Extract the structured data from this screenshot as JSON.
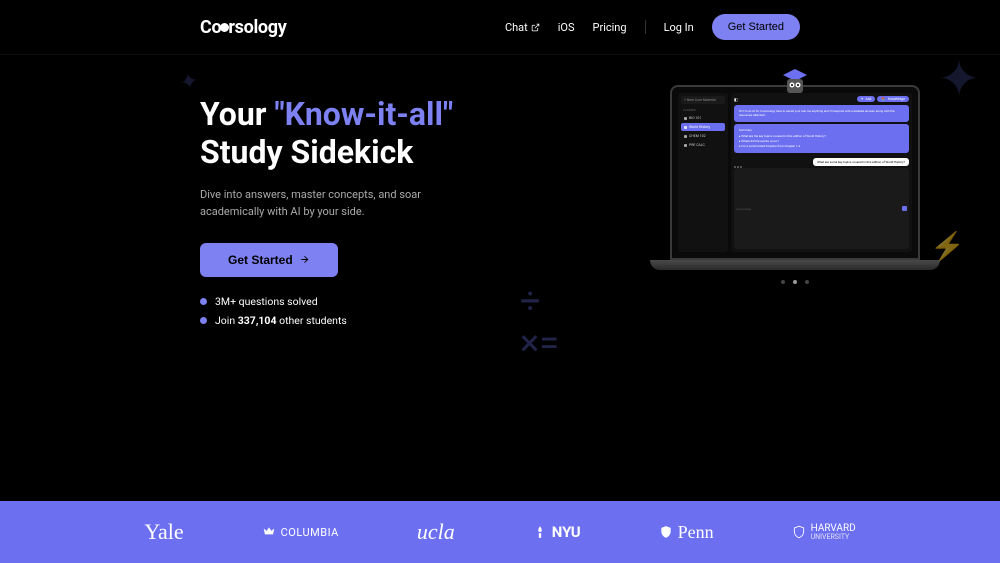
{
  "brand": "Coursology",
  "nav": {
    "chat": "Chat",
    "ios": "iOS",
    "pricing": "Pricing",
    "login": "Log In",
    "get_started": "Get Started"
  },
  "hero": {
    "headline_1": "Your ",
    "headline_accent": "\"Know-it-all\"",
    "headline_2": "Study Sidekick",
    "sub": "Dive into answers, master concepts, and soar academically with AI by your side.",
    "cta": "Get Started",
    "stat1": "3M+ questions solved",
    "stat2_pre": "Join ",
    "stat2_num": "337,104",
    "stat2_post": " other students"
  },
  "app": {
    "new_material": "+ New Core Material",
    "section": "CLASSES",
    "items": [
      "BIO 101",
      "World History",
      "CHEM 102",
      "PRE CALC"
    ],
    "top_pill1": "Ask",
    "top_pill2": "Knowledge",
    "chat_intro": "Hi! I'm an AI for Coursology here to assist you! Ask me anything and I'll respond with a detailed answer, along with the resources attached.",
    "chat_header": "Summary",
    "chat_lines": [
      "What are the key topics covered in this edition of World History?",
      "Where did the events occur?",
      "For a summarized timeline from Chapter 1-4"
    ],
    "user_msg": "What are some key topics covered in this edition of World History?",
    "input_placeholder": "Coursology"
  },
  "universities": [
    "Yale",
    "COLUMBIA",
    "ucla",
    "NYU",
    "Penn",
    "HARVARD"
  ]
}
